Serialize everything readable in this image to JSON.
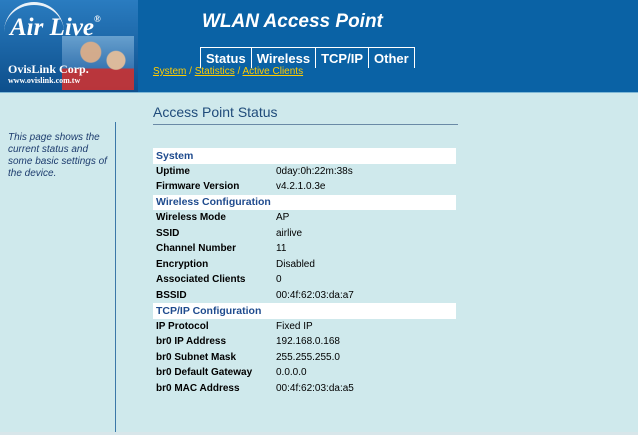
{
  "brand": {
    "logo_text": "Air Live",
    "logo_mark": "®",
    "corp": "OvisLink Corp.",
    "url": "www.ovislink.com.tw"
  },
  "app_title": "WLAN Access Point",
  "tabs": [
    {
      "label": "Status"
    },
    {
      "label": "Wireless"
    },
    {
      "label": "TCP/IP"
    },
    {
      "label": "Other"
    }
  ],
  "breadcrumb": {
    "items": [
      "System",
      "Statistics",
      "Active Clients"
    ],
    "separator": "/"
  },
  "sidebar": {
    "help_text": "This page shows the current status and some basic settings of the device."
  },
  "main": {
    "title": "Access Point Status",
    "sections": [
      {
        "heading": "System",
        "rows": [
          {
            "key": "Uptime",
            "value": "0day:0h:22m:38s"
          },
          {
            "key": "Firmware Version",
            "value": "v4.2.1.0.3e"
          }
        ]
      },
      {
        "heading": "Wireless Configuration",
        "rows": [
          {
            "key": "Wireless Mode",
            "value": "AP"
          },
          {
            "key": "SSID",
            "value": "airlive"
          },
          {
            "key": "Channel Number",
            "value": "11"
          },
          {
            "key": "Encryption",
            "value": "Disabled"
          },
          {
            "key": "Associated Clients",
            "value": "0"
          },
          {
            "key": "BSSID",
            "value": "00:4f:62:03:da:a7"
          }
        ]
      },
      {
        "heading": "TCP/IP Configuration",
        "rows": [
          {
            "key": "IP Protocol",
            "value": "Fixed IP"
          },
          {
            "key": "br0 IP Address",
            "value": "192.168.0.168"
          },
          {
            "key": "br0 Subnet Mask",
            "value": "255.255.255.0"
          },
          {
            "key": "br0 Default Gateway",
            "value": "0.0.0.0"
          },
          {
            "key": "br0 MAC Address",
            "value": "00:4f:62:03:da:a5"
          }
        ]
      }
    ]
  },
  "colors": {
    "header_bg": "#0a62a5",
    "page_bg": "#cfe9ec",
    "breadcrumb_link": "#ffcc00",
    "section_heading": "#1f4b8e"
  }
}
